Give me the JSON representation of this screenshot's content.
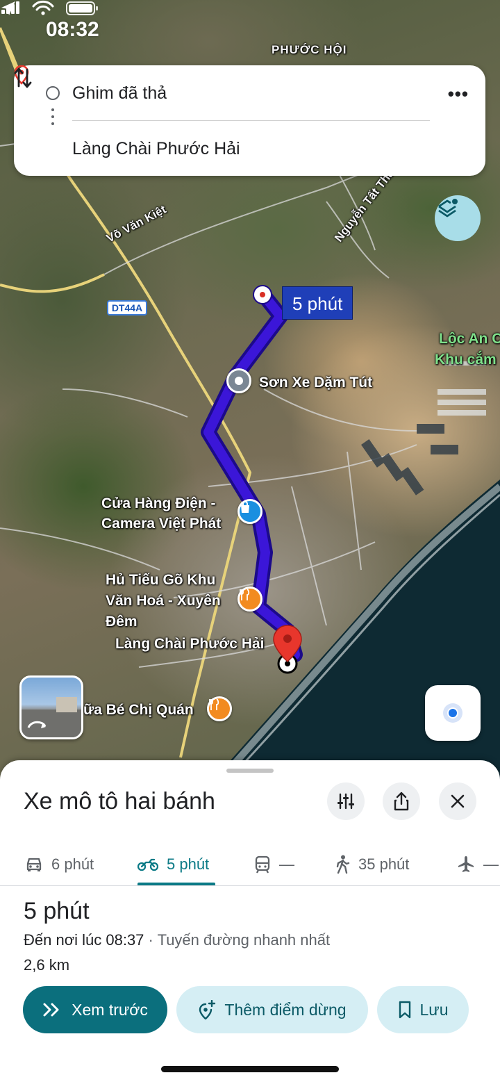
{
  "status_bar": {
    "time": "08:32"
  },
  "map": {
    "labels": {
      "phuoc_hoi": "PHƯỚC HỘI",
      "vo_van_kiet": "Võ Văn Kiệt",
      "nguyen_tat_thanh": "Nguyễn Tất Thà",
      "dt44a": "DT44A",
      "loc_an": "Lộc An C",
      "khu_cam": "Khu cắm",
      "son_xe": "Sơn Xe Dặm Tút",
      "cua_hang_line1": "Cửa Hàng Điện -",
      "cua_hang_line2": "Camera Việt Phát",
      "hu_tieu_line1": "Hủ Tiếu Gõ Khu",
      "hu_tieu_line2": "Văn Hoá - Xuyên",
      "hu_tieu_line3": "Đêm",
      "lang_chai": "Làng Chài Phước Hải",
      "be_chi_quan": "ữa Bé Chị Quán"
    },
    "route_eta": "5 phút",
    "colors": {
      "route": "#3b16d8",
      "route_outline": "#1c0a8a",
      "pin": "#e8362c"
    }
  },
  "route_card": {
    "origin": "Ghim đã thả",
    "destination": "Làng Chài Phước Hải"
  },
  "sheet": {
    "title": "Xe mô tô hai bánh",
    "modes": [
      {
        "icon": "car-icon",
        "label": "6 phút"
      },
      {
        "icon": "motorbike-icon",
        "label": "5 phút",
        "active": true
      },
      {
        "icon": "transit-icon",
        "label": "—"
      },
      {
        "icon": "walk-icon",
        "label": "35 phút"
      },
      {
        "icon": "flight-icon",
        "label": "—"
      }
    ],
    "duration": "5 phút",
    "arrival_prefix": "Đến nơi lúc 08:37",
    "arrival_sep": " · ",
    "arrival_note": "Tuyến đường nhanh nhất",
    "distance": "2,6 km",
    "buttons": {
      "preview": "Xem trước",
      "add_stop": "Thêm điểm dừng",
      "save": "Lưu"
    },
    "accent": "#0b7a86"
  }
}
